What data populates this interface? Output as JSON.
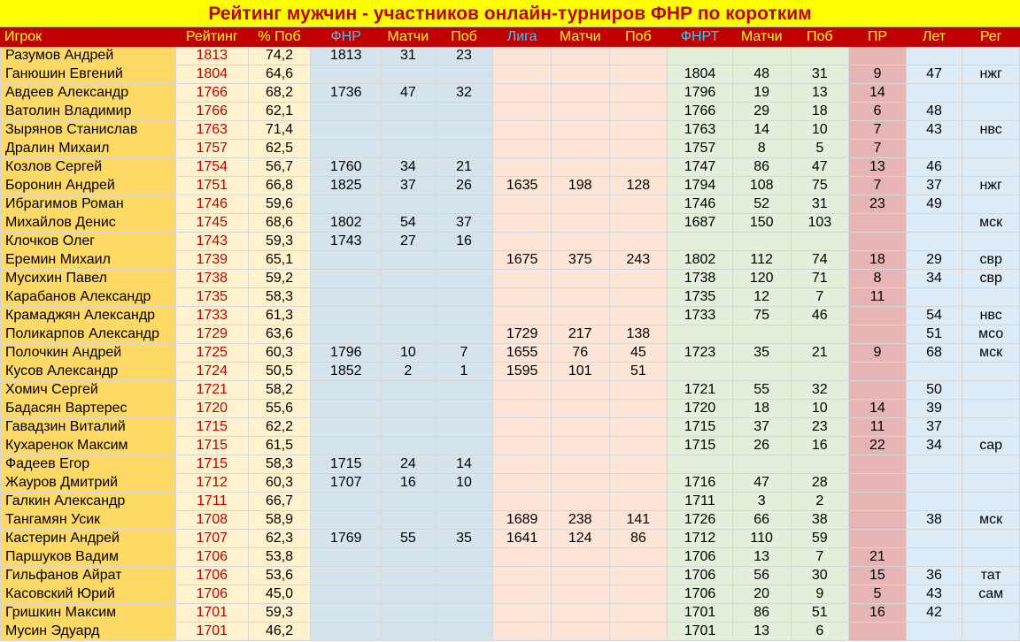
{
  "title": "Рейтинг мужчин - участников онлайн-турниров ФНР по коротким",
  "headers": [
    "Игрок",
    "Рейтинг",
    "% Поб",
    "ФНР",
    "Матчи",
    "Поб",
    "Лига",
    "Матчи",
    "Поб",
    "ФНРТ",
    "Матчи",
    "Поб",
    "ПР",
    "Лет",
    "Рег"
  ],
  "colors": {
    "title_bg": "#ffff00",
    "title_text": "#c00000",
    "header_bg": "#c00000",
    "header_text": "#ffff00",
    "header_accent": "#33ccff",
    "name_bg": "#ffd966",
    "rating_text": "#c00000",
    "rating_bg": "#fff2cc",
    "fnr_bg": "#d5e3ec",
    "liga_bg": "#fce4d6",
    "fnrt_bg": "#e2efda",
    "pr_bg": "#e6b4b4",
    "let_bg": "#ddebf7"
  },
  "rows": [
    [
      "Разумов Андрей",
      "1813",
      "74,2",
      "1813",
      "31",
      "23",
      "",
      "",
      "",
      "",
      "",
      "",
      "",
      "",
      ""
    ],
    [
      "Ганюшин Евгений",
      "1804",
      "64,6",
      "",
      "",
      "",
      "",
      "",
      "",
      "1804",
      "48",
      "31",
      "9",
      "47",
      "нжг"
    ],
    [
      "Авдеев Александр",
      "1766",
      "68,2",
      "1736",
      "47",
      "32",
      "",
      "",
      "",
      "1796",
      "19",
      "13",
      "14",
      "",
      ""
    ],
    [
      "Ватолин Владимир",
      "1766",
      "62,1",
      "",
      "",
      "",
      "",
      "",
      "",
      "1766",
      "29",
      "18",
      "6",
      "48",
      ""
    ],
    [
      "Зырянов Станислав",
      "1763",
      "71,4",
      "",
      "",
      "",
      "",
      "",
      "",
      "1763",
      "14",
      "10",
      "7",
      "43",
      "нвс"
    ],
    [
      "Дралин Михаил",
      "1757",
      "62,5",
      "",
      "",
      "",
      "",
      "",
      "",
      "1757",
      "8",
      "5",
      "7",
      "",
      ""
    ],
    [
      "Козлов Сергей",
      "1754",
      "56,7",
      "1760",
      "34",
      "21",
      "",
      "",
      "",
      "1747",
      "86",
      "47",
      "13",
      "46",
      ""
    ],
    [
      "Боронин Андрей",
      "1751",
      "66,8",
      "1825",
      "37",
      "26",
      "1635",
      "198",
      "128",
      "1794",
      "108",
      "75",
      "7",
      "37",
      "нжг"
    ],
    [
      "Ибрагимов Роман",
      "1746",
      "59,6",
      "",
      "",
      "",
      "",
      "",
      "",
      "1746",
      "52",
      "31",
      "23",
      "49",
      ""
    ],
    [
      "Михайлов Денис",
      "1745",
      "68,6",
      "1802",
      "54",
      "37",
      "",
      "",
      "",
      "1687",
      "150",
      "103",
      "",
      "",
      "мск"
    ],
    [
      "Клочков Олег",
      "1743",
      "59,3",
      "1743",
      "27",
      "16",
      "",
      "",
      "",
      "",
      "",
      "",
      "",
      "",
      ""
    ],
    [
      "Еремин Михаил",
      "1739",
      "65,1",
      "",
      "",
      "",
      "1675",
      "375",
      "243",
      "1802",
      "112",
      "74",
      "18",
      "29",
      "свр"
    ],
    [
      "Мусихин Павел",
      "1738",
      "59,2",
      "",
      "",
      "",
      "",
      "",
      "",
      "1738",
      "120",
      "71",
      "8",
      "34",
      "свр"
    ],
    [
      "Карабанов Александр",
      "1735",
      "58,3",
      "",
      "",
      "",
      "",
      "",
      "",
      "1735",
      "12",
      "7",
      "11",
      "",
      ""
    ],
    [
      "Крамаджян Александр",
      "1733",
      "61,3",
      "",
      "",
      "",
      "",
      "",
      "",
      "1733",
      "75",
      "46",
      "",
      "54",
      "нвс"
    ],
    [
      "Поликарпов Александр",
      "1729",
      "63,6",
      "",
      "",
      "",
      "1729",
      "217",
      "138",
      "",
      "",
      "",
      "",
      "51",
      "мсо"
    ],
    [
      "Полочкин Андрей",
      "1725",
      "60,3",
      "1796",
      "10",
      "7",
      "1655",
      "76",
      "45",
      "1723",
      "35",
      "21",
      "9",
      "68",
      "мск"
    ],
    [
      "Кусов Александр",
      "1724",
      "50,5",
      "1852",
      "2",
      "1",
      "1595",
      "101",
      "51",
      "",
      "",
      "",
      "",
      "",
      ""
    ],
    [
      "Хомич Сергей",
      "1721",
      "58,2",
      "",
      "",
      "",
      "",
      "",
      "",
      "1721",
      "55",
      "32",
      "",
      "50",
      ""
    ],
    [
      "Бадасян Вартерес",
      "1720",
      "55,6",
      "",
      "",
      "",
      "",
      "",
      "",
      "1720",
      "18",
      "10",
      "14",
      "39",
      ""
    ],
    [
      "Гавадзин Виталий",
      "1715",
      "62,2",
      "",
      "",
      "",
      "",
      "",
      "",
      "1715",
      "37",
      "23",
      "11",
      "37",
      ""
    ],
    [
      "Кухаренок Максим",
      "1715",
      "61,5",
      "",
      "",
      "",
      "",
      "",
      "",
      "1715",
      "26",
      "16",
      "22",
      "34",
      "сар"
    ],
    [
      "Фадеев Егор",
      "1715",
      "58,3",
      "1715",
      "24",
      "14",
      "",
      "",
      "",
      "",
      "",
      "",
      "",
      "",
      ""
    ],
    [
      "Жауров Дмитрий",
      "1712",
      "60,3",
      "1707",
      "16",
      "10",
      "",
      "",
      "",
      "1716",
      "47",
      "28",
      "",
      "",
      ""
    ],
    [
      "Галкин Александр",
      "1711",
      "66,7",
      "",
      "",
      "",
      "",
      "",
      "",
      "1711",
      "3",
      "2",
      "",
      "",
      ""
    ],
    [
      "Тангамян Усик",
      "1708",
      "58,9",
      "",
      "",
      "",
      "1689",
      "238",
      "141",
      "1726",
      "66",
      "38",
      "",
      "38",
      "мск"
    ],
    [
      "Кастерин Андрей",
      "1707",
      "62,3",
      "1769",
      "55",
      "35",
      "1641",
      "124",
      "86",
      "1712",
      "110",
      "59",
      "",
      "",
      ""
    ],
    [
      "Паршуков Вадим",
      "1706",
      "53,8",
      "",
      "",
      "",
      "",
      "",
      "",
      "1706",
      "13",
      "7",
      "21",
      "",
      ""
    ],
    [
      "Гильфанов Айрат",
      "1706",
      "53,6",
      "",
      "",
      "",
      "",
      "",
      "",
      "1706",
      "56",
      "30",
      "15",
      "36",
      "тат"
    ],
    [
      "Касовский Юрий",
      "1706",
      "45,0",
      "",
      "",
      "",
      "",
      "",
      "",
      "1706",
      "20",
      "9",
      "5",
      "43",
      "сам"
    ],
    [
      "Гришкин Максим",
      "1701",
      "59,3",
      "",
      "",
      "",
      "",
      "",
      "",
      "1701",
      "86",
      "51",
      "16",
      "42",
      ""
    ],
    [
      "Мусин Эдуард",
      "1701",
      "46,2",
      "",
      "",
      "",
      "",
      "",
      "",
      "1701",
      "13",
      "6",
      "",
      "",
      ""
    ]
  ]
}
